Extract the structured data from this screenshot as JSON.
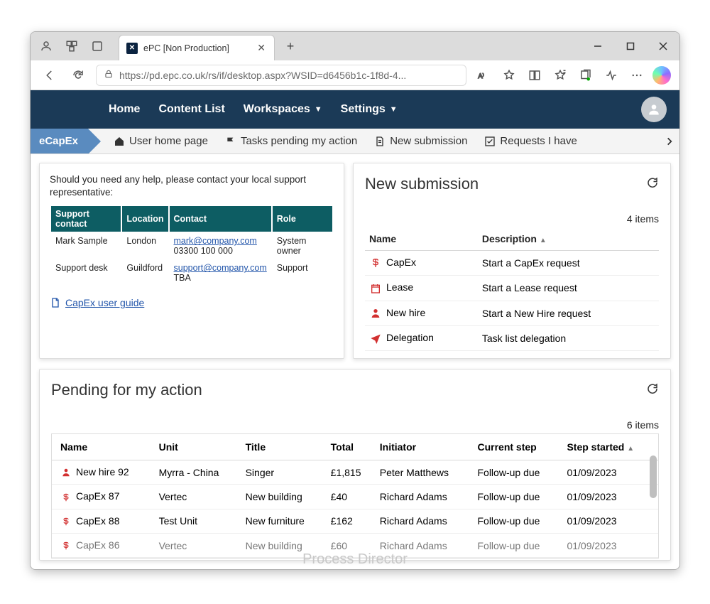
{
  "browser": {
    "tab_title": "ePC [Non Production]",
    "url": "https://pd.epc.co.uk/rs/if/desktop.aspx?WSID=d6456b1c-1f8d-4..."
  },
  "menubar": {
    "items": [
      "Home",
      "Content List",
      "Workspaces",
      "Settings"
    ]
  },
  "breadcrumb": {
    "label": "eCapEx",
    "items": [
      {
        "icon": "home",
        "label": "User home page"
      },
      {
        "icon": "flag",
        "label": "Tasks pending my action"
      },
      {
        "icon": "doc",
        "label": "New submission"
      },
      {
        "icon": "check",
        "label": "Requests I have"
      }
    ]
  },
  "help": {
    "message": "Should you need any help, please contact your local support representative:",
    "headers": [
      "Support contact",
      "Location",
      "Contact",
      "Role"
    ],
    "rows": [
      {
        "c0": "Mark Sample",
        "c1": "London",
        "c2a": "mark@company.com",
        "c2b": "03300 100 000",
        "c3": "System owner"
      },
      {
        "c0": "Support desk",
        "c1": "Guildford",
        "c2a": "support@company.com",
        "c2b": "TBA",
        "c3": "Support"
      }
    ],
    "guide": "CapEx user guide"
  },
  "new_submission": {
    "title": "New submission",
    "count": "4 items",
    "headers": {
      "name": "Name",
      "desc": "Description"
    },
    "rows": [
      {
        "icon": "dollar",
        "name": "CapEx",
        "desc": "Start a CapEx request"
      },
      {
        "icon": "calendar",
        "name": "Lease",
        "desc": "Start a Lease request"
      },
      {
        "icon": "person",
        "name": "New hire",
        "desc": "Start a New Hire request"
      },
      {
        "icon": "plane",
        "name": "Delegation",
        "desc": "Task list delegation"
      }
    ]
  },
  "pending": {
    "title": "Pending for my action",
    "count": "6 items",
    "headers": {
      "name": "Name",
      "unit": "Unit",
      "title": "Title",
      "total": "Total",
      "initiator": "Initiator",
      "step": "Current step",
      "started": "Step started"
    },
    "rows": [
      {
        "icon": "person",
        "name": "New hire 92",
        "unit": "Myrra - China",
        "title": "Singer",
        "total": "£1,815",
        "initiator": "Peter Matthews",
        "step": "Follow-up due",
        "started": "01/09/2023"
      },
      {
        "icon": "dollar",
        "name": "CapEx 87",
        "unit": "Vertec",
        "title": "New building",
        "total": "£40",
        "initiator": "Richard Adams",
        "step": "Follow-up due",
        "started": "01/09/2023"
      },
      {
        "icon": "dollar",
        "name": "CapEx 88",
        "unit": "Test Unit",
        "title": "New furniture",
        "total": "£162",
        "initiator": "Richard Adams",
        "step": "Follow-up due",
        "started": "01/09/2023"
      },
      {
        "icon": "dollar",
        "name": "CapEx 86",
        "unit": "Vertec",
        "title": "New building",
        "total": "£60",
        "initiator": "Richard Adams",
        "step": "Follow-up due",
        "started": "01/09/2023"
      }
    ]
  },
  "watermark": "Process Director"
}
